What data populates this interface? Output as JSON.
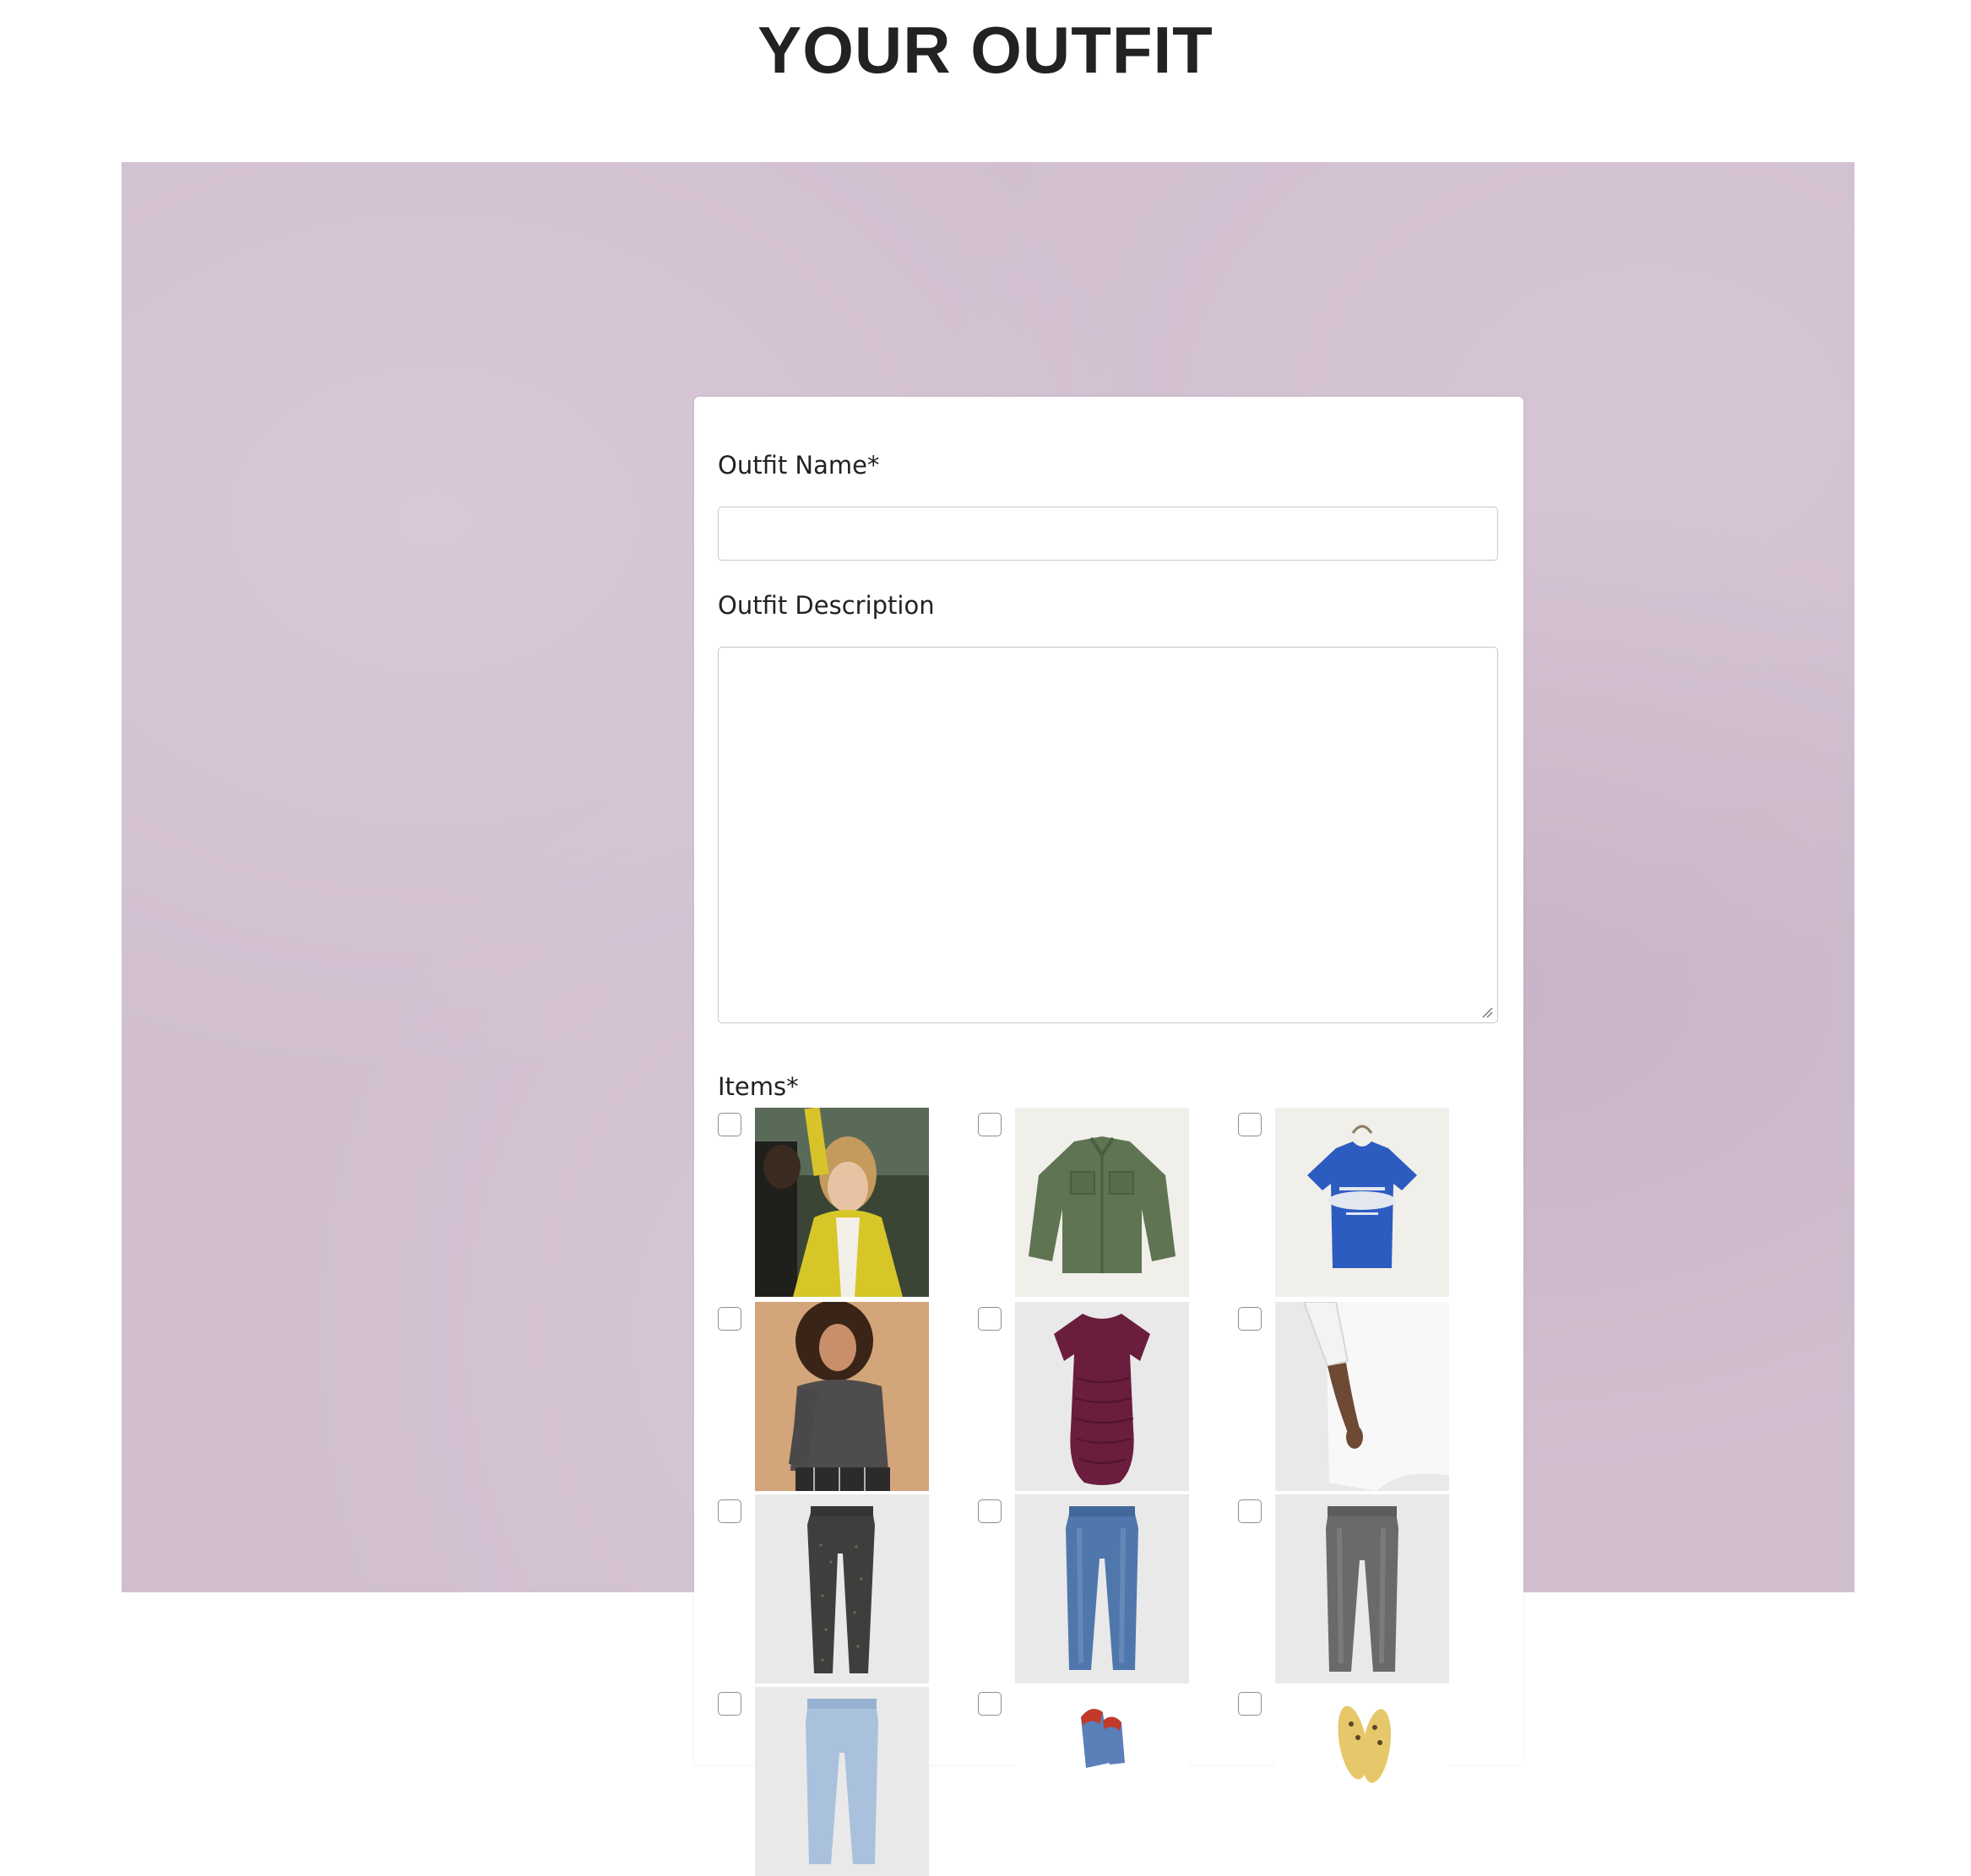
{
  "page": {
    "title": "YOUR OUTFIT"
  },
  "form": {
    "name_label": "Outfit Name*",
    "name_value": "",
    "name_placeholder": "",
    "description_label": "Outfit Description",
    "description_value": "",
    "description_placeholder": "",
    "items_label": "Items*"
  },
  "items": [
    {
      "icon": "movie-scene-yellow-cardigan-image",
      "checked": false
    },
    {
      "icon": "green-utility-jacket-image",
      "checked": false
    },
    {
      "icon": "blue-graphic-tee-image",
      "checked": false
    },
    {
      "icon": "grey-sweater-model-image",
      "checked": false
    },
    {
      "icon": "burgundy-ruched-dress-image",
      "checked": false
    },
    {
      "icon": "white-shirt-dress-image",
      "checked": false
    },
    {
      "icon": "black-print-jeans-image",
      "checked": false
    },
    {
      "icon": "blue-jeans-image",
      "checked": false
    },
    {
      "icon": "grey-jeans-image",
      "checked": false
    },
    {
      "icon": "light-wash-jeans-image",
      "checked": false
    },
    {
      "icon": "socks-image",
      "checked": false
    },
    {
      "icon": "yellow-sandals-image",
      "checked": false
    }
  ],
  "colors": {
    "backdrop": "#d1bfd0",
    "card": "#ffffff",
    "title": "#222222"
  }
}
